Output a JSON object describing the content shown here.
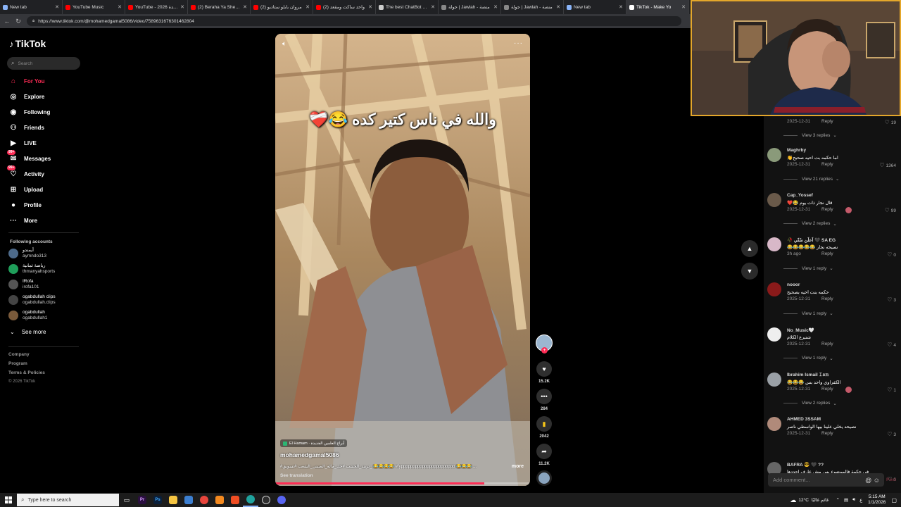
{
  "browser": {
    "tabs": [
      {
        "title": "New tab",
        "color": "#8ab4f8",
        "active": false
      },
      {
        "title": "YouTube Music",
        "color": "#ff0000",
        "active": false
      },
      {
        "title": "YouTube - 2026 سنة جديدة",
        "color": "#ff0000",
        "active": false
      },
      {
        "title": "(2) Beraha Ya Sheekha",
        "color": "#ff0000",
        "active": false
      },
      {
        "title": "(2) مروان بابلو ستاديو",
        "color": "#ff0000",
        "active": false
      },
      {
        "title": "(2) واحد ساكت ومقعد",
        "color": "#ff0000",
        "active": false
      },
      {
        "title": "The best ChatBot and",
        "color": "#cccccc",
        "active": false
      },
      {
        "title": "جولة | Jawlah - منصة",
        "color": "#888888",
        "active": false
      },
      {
        "title": "جولة | Jawlah - منصة",
        "color": "#888888",
        "active": false
      },
      {
        "title": "New tab",
        "color": "#8ab4f8",
        "active": false
      },
      {
        "title": "TikTok - Make Yo",
        "color": "#ffffff",
        "active": true
      }
    ],
    "url": "https://www.tiktok.com/@mohamedgamal5086/video/7589631676301462804"
  },
  "sidebar": {
    "logo": "TikTok",
    "search_placeholder": "Search",
    "nav": [
      {
        "label": "For You",
        "icon": "home-icon",
        "active": true
      },
      {
        "label": "Explore",
        "icon": "compass-icon",
        "active": false
      },
      {
        "label": "Following",
        "icon": "following-icon",
        "active": false
      },
      {
        "label": "Friends",
        "icon": "friends-icon",
        "active": false
      },
      {
        "label": "LIVE",
        "icon": "live-icon",
        "active": false
      },
      {
        "label": "Messages",
        "icon": "messages-icon",
        "active": false,
        "badge": "99+"
      },
      {
        "label": "Activity",
        "icon": "activity-icon",
        "active": false,
        "badge": "99+"
      },
      {
        "label": "Upload",
        "icon": "upload-icon",
        "active": false
      },
      {
        "label": "Profile",
        "icon": "profile-icon",
        "active": false
      },
      {
        "label": "More",
        "icon": "more-icon",
        "active": false
      }
    ],
    "following_title": "Following accounts",
    "accounts": [
      {
        "name": "أيمندو",
        "handle": "aymndo313",
        "color": "#4d6a8a"
      },
      {
        "name": "رياضة ثمانية",
        "handle": "thmanyahsports",
        "color": "#1f9e5a"
      },
      {
        "name": "IRofa",
        "handle": "irofa101",
        "color": "#555555"
      },
      {
        "name": "ogabdullah clips",
        "handle": "ogabdullah.clips",
        "color": "#444444"
      },
      {
        "name": "ogabdullah",
        "handle": "ogabdullah1",
        "color": "#7a5a3a"
      }
    ],
    "see_more": "See more",
    "footer": [
      "Company",
      "Program",
      "Terms & Policies"
    ],
    "copyright": "© 2026 TikTok"
  },
  "video": {
    "caption": "والله في ناس كتير كده 😂❤️‍🩹",
    "tag": "El Hamam · أبراج العلمين الجديدة",
    "username": "mohamedgamal5086",
    "description": "#تريند_الخشب #حل_ماله_الصيني_الشعب #تسويق_ 😂😂😂😂 #fyppppppppppppppppppppppp 😂😂😂 ...",
    "more": "more",
    "see_translation": "See translation",
    "progress": 0.82
  },
  "actions": {
    "likes": "15.2K",
    "comments": "284",
    "saves": "2042",
    "shares": "11.2K"
  },
  "comments": {
    "top_item": {
      "date": "2025-12-31",
      "reply": "Reply",
      "likes": "19",
      "view_replies": "View 3 replies"
    },
    "items": [
      {
        "user": "Maghrby",
        "text": "اما حكمه بت احيه صحيح👏",
        "date": "2025-12-31",
        "reply": "Reply",
        "likes": "1364",
        "view_replies": "View 21 replies",
        "avatar": "#8a9a7a"
      },
      {
        "user": "Cap_Yossef",
        "text": "قال نجار ذات يوم 😂❤️",
        "date": "2025-12-31",
        "reply": "Reply",
        "likes": "99",
        "view_replies": "View 2 replies",
        "avatar": "#6a5a4a",
        "author_liked": true
      },
      {
        "user": "🥀 اَعلَن سُنّي 🖤 SA EG",
        "text": "نصيحه نجار 😂😂😂😂😂",
        "date": "3h ago",
        "reply": "Reply",
        "likes": "0",
        "view_replies": "View 1 reply",
        "avatar": "#d8b8c8"
      },
      {
        "user": "nooor",
        "text": "حكمه بنت احيه بصحيح",
        "date": "2025-12-31",
        "reply": "Reply",
        "likes": "3",
        "view_replies": "View 1 reply",
        "avatar": "#8a1a1a"
      },
      {
        "user": "No_Music🤍",
        "text": "شتيرع الكلام",
        "date": "2025-12-31",
        "reply": "Reply",
        "likes": "4",
        "view_replies": "View 1 reply",
        "avatar": "#eeeeee"
      },
      {
        "user": "Ibrahim Ismail 𝙸𝚜𝚖",
        "text": "الكفراوي واحد بس 😂😂😂",
        "date": "2025-12-31",
        "reply": "Reply",
        "likes": "1",
        "view_replies": "View 2 replies",
        "avatar": "#9aa0a6",
        "author_liked": true
      },
      {
        "user": "AHMED 3SSAM",
        "text": "نصيحه يخلي علينا بيها الواسطي ناصر",
        "date": "2025-12-31",
        "reply": "Reply",
        "likes": "3",
        "avatar": "#b08a7a"
      },
      {
        "user": "BAFRA 😎 🖤 ??",
        "text": "في حكمة فالموضوع بس مش عارف احددها",
        "date": "2025-12-31",
        "reply": "Reply",
        "likes": "0",
        "avatar": "#666666"
      }
    ],
    "input_placeholder": "Add comment...",
    "post": "Post"
  },
  "taskbar": {
    "search_placeholder": "Type here to search",
    "weather_temp": "12°C",
    "weather_text": "غائم غالبًا",
    "time": "5:15 AM",
    "date": "1/1/2026",
    "lang": "ع"
  },
  "colors": {
    "accent": "#fe2c55",
    "webcam_border": "#e4a72b"
  }
}
